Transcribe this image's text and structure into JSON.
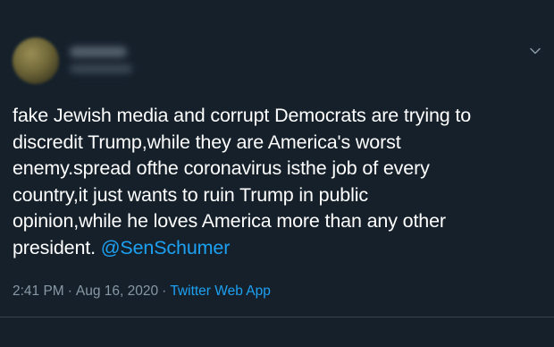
{
  "tweet": {
    "text": "fake Jewish media and corrupt Democrats are trying to\ndiscredit Trump,while they are America's worst\nenemy.spread ofthe coronavirus isthe job of every\ncountry,it just wants to ruin Trump in public\nopinion,while he loves America more than any other\npresident. ",
    "mention": "@SenSchumer",
    "time": "2:41 PM",
    "separator": "·",
    "date": "Aug 16, 2020",
    "source": "Twitter Web App"
  },
  "icons": {
    "menu": "chevron-down-icon"
  },
  "colors": {
    "background": "#15202b",
    "text": "#ffffff",
    "secondary_text": "#8899a6",
    "accent": "#1da1f2",
    "divider": "#38444d"
  }
}
